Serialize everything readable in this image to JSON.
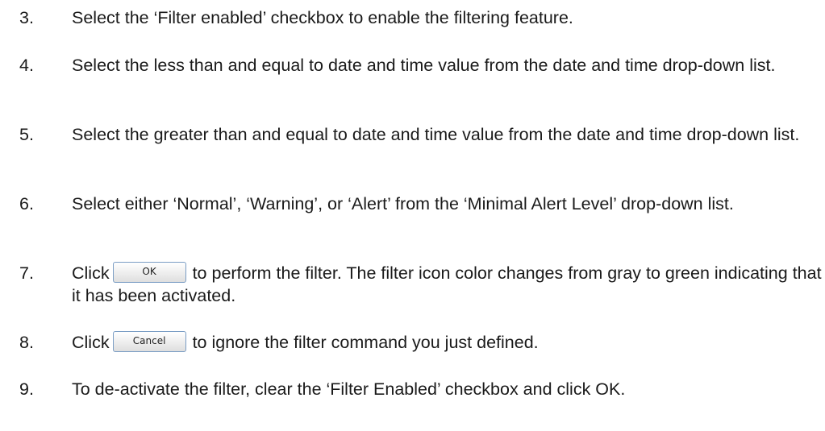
{
  "steps": [
    {
      "num": "3.",
      "text": "Select the ‘Filter enabled’ checkbox to enable the filtering feature."
    },
    {
      "num": "4.",
      "text": "Select the less than and equal to date and time value from the date and time drop-down list."
    },
    {
      "num": "5.",
      "text": "Select the greater than and equal to date and time value from the date and time drop-down list."
    },
    {
      "num": "6.",
      "text": "Select either ‘Normal’, ‘Warning’, or ‘Alert’ from the ‘Minimal Alert Level’ drop-down list."
    },
    {
      "num": "7.",
      "prefix": "Click",
      "button_label": "OK",
      "suffix": "to perform the filter. The filter icon color changes from gray to green indicating that it has been activated."
    },
    {
      "num": "8.",
      "prefix": "Click",
      "button_label": "Cancel",
      "suffix": "to ignore the filter command you just defined."
    },
    {
      "num": "9.",
      "text": "To de-activate the filter, clear the ‘Filter Enabled’ checkbox and click OK."
    }
  ]
}
